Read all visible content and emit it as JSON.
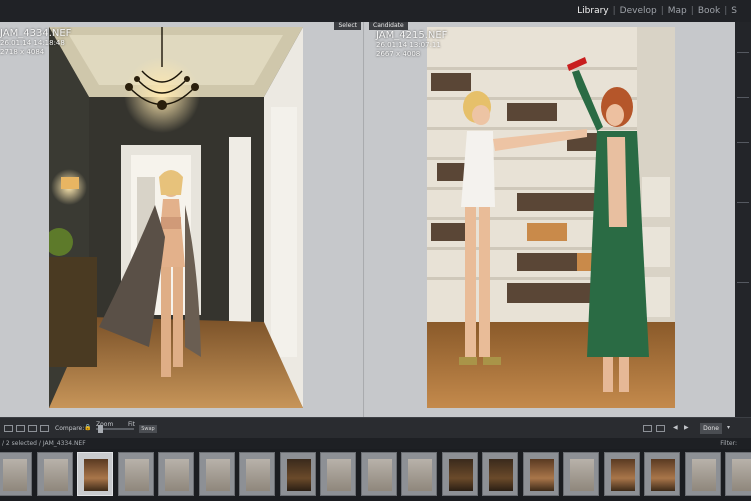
{
  "modules": {
    "items": [
      "Library",
      "Develop",
      "Map",
      "Book"
    ],
    "separator": "|",
    "overflow": "S"
  },
  "compare": {
    "select": {
      "tag": "Select",
      "filename": "JAM_4334.NEF",
      "datetime": "26.01.14 14:18:48",
      "dimensions": "2718 x 4084"
    },
    "candidate": {
      "tag": "Candidate",
      "filename": "JAM_4215.NEF",
      "datetime": "26.01.14 13:07:11",
      "dimensions": "2667 x 4008"
    }
  },
  "toolbar": {
    "compare_label": "Compare:",
    "zoom_label": "Zoom",
    "fit_label": "Fit",
    "done_label": "Done",
    "swap_label": "Swap"
  },
  "filmstrip": {
    "breadcrumb": "/ 2 selected / JAM_4334.NEF",
    "filter_label": "Filter:",
    "cells": [
      "light",
      "light",
      "warm",
      "light",
      "light",
      "light",
      "light",
      "dark",
      "light",
      "light",
      "light",
      "dark",
      "dark",
      "warm",
      "light",
      "warm",
      "warm",
      "light",
      "light"
    ],
    "selected_index": 2
  },
  "colors": {
    "app_bg": "#1a1c20",
    "workspace_bg": "#c5c7ca",
    "panel_dark": "#2a2c30"
  }
}
